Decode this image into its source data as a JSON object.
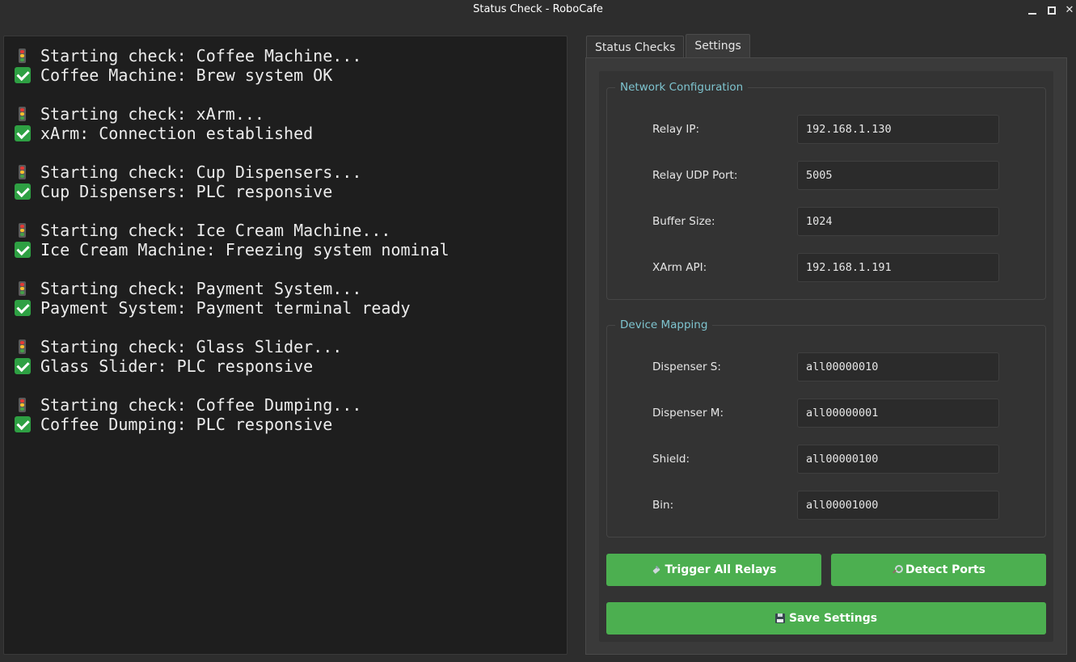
{
  "window": {
    "title": "Status Check - RoboCafe",
    "minimize_label": "",
    "maximize_label": "",
    "close_label": "✕"
  },
  "log": [
    {
      "start": "Starting check: Coffee Machine...",
      "result": "Coffee Machine: Brew system OK"
    },
    {
      "start": "Starting check: xArm...",
      "result": "xArm: Connection established"
    },
    {
      "start": "Starting check: Cup Dispensers...",
      "result": "Cup Dispensers: PLC responsive"
    },
    {
      "start": "Starting check: Ice Cream Machine...",
      "result": "Ice Cream Machine: Freezing system nominal"
    },
    {
      "start": "Starting check: Payment System...",
      "result": "Payment System: Payment terminal ready"
    },
    {
      "start": "Starting check: Glass Slider...",
      "result": "Glass Slider: PLC responsive"
    },
    {
      "start": "Starting check: Coffee Dumping...",
      "result": "Coffee Dumping: PLC responsive"
    }
  ],
  "log_icons": {
    "start": "traffic-light-icon",
    "result": "check-mark-icon"
  },
  "tabs": {
    "status_checks": "Status Checks",
    "settings": "Settings",
    "active": "settings"
  },
  "network": {
    "legend": "Network Configuration",
    "fields": [
      {
        "label": "Relay IP:",
        "value": "192.168.1.130"
      },
      {
        "label": "Relay UDP Port:",
        "value": "5005"
      },
      {
        "label": "Buffer Size:",
        "value": "1024"
      },
      {
        "label": "XArm API:",
        "value": "192.168.1.191"
      }
    ]
  },
  "device": {
    "legend": "Device Mapping",
    "fields": [
      {
        "label": "Dispenser S:",
        "value": "all00000010"
      },
      {
        "label": "Dispenser M:",
        "value": "all00000001"
      },
      {
        "label": "Shield:",
        "value": "all00000100"
      },
      {
        "label": "Bin:",
        "value": "all00001000"
      }
    ]
  },
  "buttons": {
    "trigger": "Trigger All Relays",
    "detect": "Detect Ports",
    "save": "Save Settings"
  },
  "colors": {
    "accent_green": "#4caf50",
    "legend_text": "#7ec4cf",
    "console_bg": "#1e1e1e"
  }
}
